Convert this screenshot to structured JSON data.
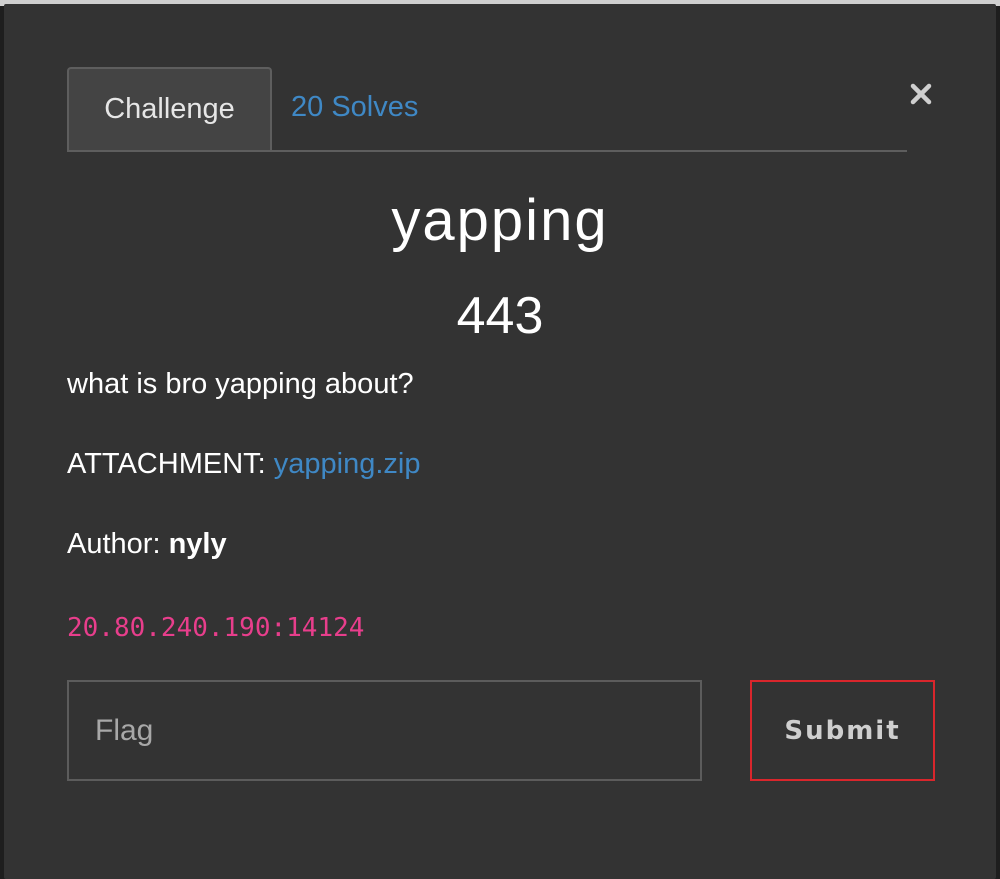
{
  "tabs": {
    "challenge_label": "Challenge",
    "solves_label": "20 Solves"
  },
  "challenge": {
    "name": "yapping",
    "points": "443",
    "description": "what is bro yapping about?",
    "attachment_label": "ATTACHMENT: ",
    "attachment_file": "yapping.zip",
    "author_label": "Author: ",
    "author_name": "nyly",
    "address": "20.80.240.190:14124"
  },
  "form": {
    "flag_placeholder": "Flag",
    "flag_value": "",
    "submit_label": "Submit"
  },
  "colors": {
    "link": "#3f88c5",
    "address": "#e83e8c",
    "submit_border": "#d9262c",
    "modal_bg": "#333333"
  },
  "icons": {
    "close": "close-icon"
  }
}
